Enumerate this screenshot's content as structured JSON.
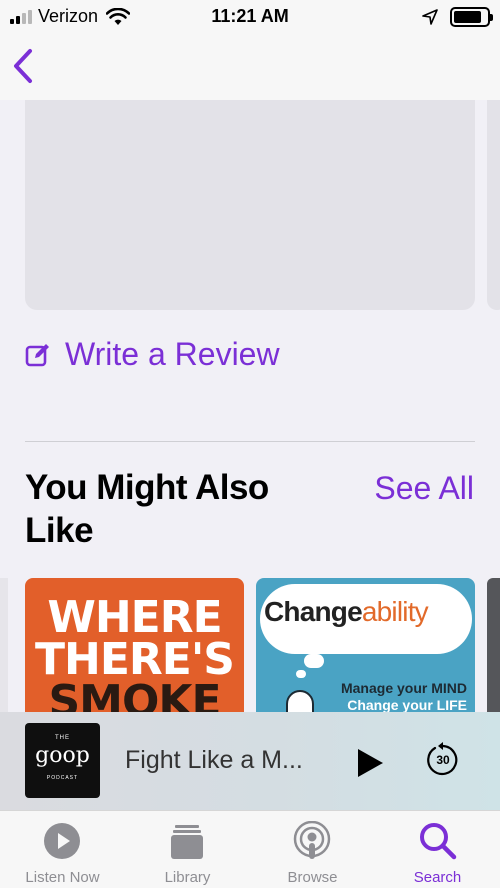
{
  "status_bar": {
    "carrier": "Verizon",
    "time": "11:21 AM",
    "signal_bars": 2,
    "battery_level": 0.85
  },
  "nav": {
    "back_icon": "chevron-left-icon"
  },
  "reviews": {
    "write_review_label": "Write a Review",
    "write_review_icon": "compose-icon"
  },
  "recommendations": {
    "title": "You Might Also Like",
    "see_all_label": "See All",
    "items": [
      {
        "art_text_lines": [
          "WHERE",
          "THERE'S",
          "SMOKE"
        ]
      },
      {
        "art_title_main": "Change",
        "art_title_accent": "ability",
        "art_line_1": "Manage your MIND",
        "art_line_2": "Change your LIFE"
      }
    ]
  },
  "now_playing": {
    "art_top": "THE",
    "art_brand": "goop",
    "art_sub": "PODCAST",
    "title": "Fight Like a M...",
    "play_icon": "play-icon",
    "skip_label": "30",
    "skip_icon": "skip-back-30-icon"
  },
  "tab_bar": {
    "tabs": [
      {
        "label": "Listen Now",
        "icon": "play-circle-icon",
        "active": false
      },
      {
        "label": "Library",
        "icon": "library-icon",
        "active": false
      },
      {
        "label": "Browse",
        "icon": "podcasts-icon",
        "active": false
      },
      {
        "label": "Search",
        "icon": "search-icon",
        "active": true
      }
    ]
  },
  "colors": {
    "accent": "#7b2fd6",
    "background": "#f1f0f6",
    "inactive_tab": "#8e8e93"
  }
}
